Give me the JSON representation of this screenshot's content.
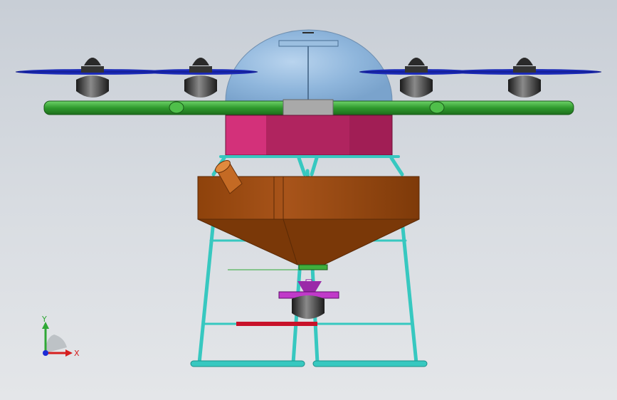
{
  "triad": {
    "x_label": "X",
    "y_label": "Y",
    "x_color": "#d61f1f",
    "y_color": "#2fa836",
    "z_color": "#1d2bd6"
  },
  "colors": {
    "background_top": "#c8ced6",
    "background_bottom": "#e4e6e9",
    "dome": "#8fb6dc",
    "arms": "#3fae3c",
    "body_pink": "#c62c6e",
    "hopper": "#a24e10",
    "landing_gear": "#37c8c0",
    "propeller": "#1c2bb8",
    "motor": "#2a2a2a",
    "nozzle_purple": "#9a2aa8",
    "spreader_red": "#c8122a"
  }
}
